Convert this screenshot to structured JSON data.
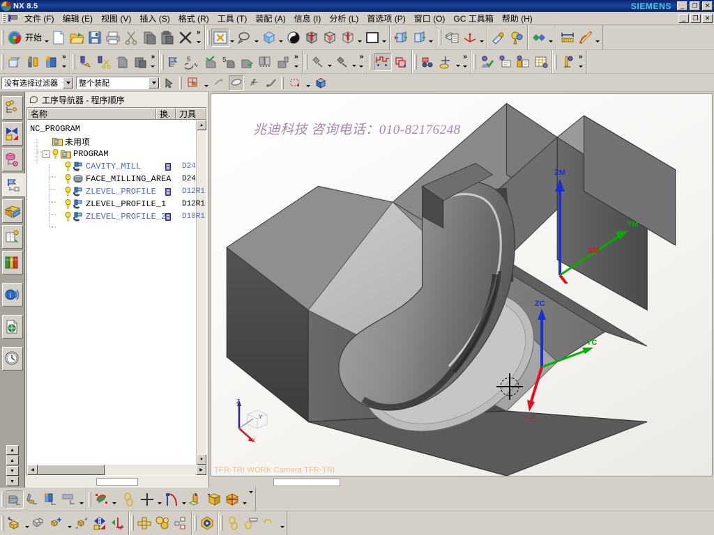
{
  "titlebar": {
    "app_title": "NX 8.5",
    "brand": "SIEMENS",
    "minimize": "_",
    "maximize": "❐",
    "close": "✕"
  },
  "menubar": {
    "items": [
      {
        "label": "文件 (F)",
        "name": "menu-file"
      },
      {
        "label": "编辑 (E)",
        "name": "menu-edit"
      },
      {
        "label": "视图 (V)",
        "name": "menu-view"
      },
      {
        "label": "插入 (S)",
        "name": "menu-insert"
      },
      {
        "label": "格式 (R)",
        "name": "menu-format"
      },
      {
        "label": "工具 (T)",
        "name": "menu-tools"
      },
      {
        "label": "装配 (A)",
        "name": "menu-assembly"
      },
      {
        "label": "信息 (I)",
        "name": "menu-information"
      },
      {
        "label": "分析 (L)",
        "name": "menu-analysis"
      },
      {
        "label": "首选项 (P)",
        "name": "menu-preferences"
      },
      {
        "label": "窗口 (O)",
        "name": "menu-window"
      },
      {
        "label": "GC 工具箱",
        "name": "menu-gc-toolbox"
      },
      {
        "label": "帮助 (H)",
        "name": "menu-help"
      }
    ],
    "min": "_",
    "max": "❐",
    "close": "✕"
  },
  "standard_toolbar": {
    "start_label": "开始",
    "buttons": [
      {
        "name": "new-file-button",
        "icon": "new-document-icon"
      },
      {
        "name": "open-file-button",
        "icon": "open-folder-icon"
      },
      {
        "name": "save-button",
        "icon": "floppy-disk-icon"
      },
      {
        "name": "print-button",
        "icon": "printer-icon"
      },
      {
        "name": "cut-button",
        "icon": "scissors-icon"
      },
      {
        "name": "copy-button",
        "icon": "copy-icon"
      },
      {
        "name": "paste-button",
        "icon": "paste-icon"
      },
      {
        "name": "delete-button",
        "icon": "x-delete-icon"
      }
    ],
    "overflow": "»"
  },
  "view_toolbar": {
    "buttons": [
      {
        "name": "fit-view-button",
        "icon": "fit-star-icon"
      },
      {
        "name": "zoom-button",
        "icon": "magnify-icon"
      },
      {
        "name": "rotate-button",
        "icon": "blue-cube-icon"
      },
      {
        "name": "shaded-render-button",
        "icon": "half-sphere-icon"
      },
      {
        "name": "shaded-edges-button",
        "icon": "shaded-box-icon"
      },
      {
        "name": "static-wireframe-button",
        "icon": "wireframe-box-icon"
      },
      {
        "name": "wireframe-button",
        "icon": "outline-box-icon"
      },
      {
        "name": "background-color-button",
        "icon": "white-square-icon"
      },
      {
        "name": "clip-section-button",
        "icon": "section-icon"
      },
      {
        "name": "section-view-button",
        "icon": "section2-icon"
      },
      {
        "name": "layer-settings-button",
        "icon": "layers-icon"
      },
      {
        "name": "wcs-dynamics-button",
        "icon": "wcs-axis-icon"
      },
      {
        "name": "measure-distance-button",
        "icon": "ruler-icon"
      },
      {
        "name": "measure-angle-button",
        "icon": "protractor-icon"
      },
      {
        "name": "move-object-button",
        "icon": "move-object-icon"
      },
      {
        "name": "analysis-button",
        "icon": "analysis-icon"
      }
    ]
  },
  "cam_toolbar": {
    "groups": [
      {
        "name": "insert-group",
        "buttons": [
          "create-geometry-icon",
          "create-tool-icon",
          "create-method-icon"
        ]
      },
      {
        "name": "operation-group",
        "buttons": [
          "create-operation-icon",
          "cut-operation-icon",
          "copy-operation-icon",
          "paste-operation-icon"
        ]
      },
      {
        "name": "generate-group",
        "buttons": [
          "generate-toolpath-icon",
          "replay-toolpath-icon",
          "verify-toolpath-icon",
          "list-toolpath-icon",
          "confirm-toolpath-icon",
          "compare-icon",
          "machine-icon"
        ]
      },
      {
        "name": "postprocess-group",
        "buttons": [
          "post-process-icon",
          "output-cls-icon"
        ]
      },
      {
        "name": "workpiece-group",
        "buttons": [
          "workpiece-icon",
          "blank-icon"
        ]
      },
      {
        "name": "simulate-group",
        "buttons": [
          "simulate-icon",
          "tool-path-icon"
        ]
      },
      {
        "name": "approve-group",
        "buttons": [
          "approve-icon",
          "shop-doc-icon",
          "report-icon",
          "spreadsheet-icon"
        ]
      },
      {
        "name": "misc-group",
        "buttons": [
          "misc-icon"
        ]
      }
    ],
    "overflow": "»"
  },
  "selection_bar": {
    "filter_value": "没有选择过滤器",
    "scope_value": "整个装配",
    "buttons": [
      {
        "name": "select-general-button",
        "icon": "select-cursor-icon"
      },
      {
        "name": "snap-point-button",
        "icon": "snap-point-icon"
      },
      {
        "name": "point-on-curve-button",
        "icon": "point-curve-icon"
      },
      {
        "name": "face-select-button",
        "icon": "face-select-icon"
      },
      {
        "name": "intersection-point-button",
        "icon": "intersection-icon"
      },
      {
        "name": "curve-select-button",
        "icon": "curve-select-icon"
      },
      {
        "name": "rectangle-select-button",
        "icon": "rect-select-icon"
      },
      {
        "name": "orient-view-button",
        "icon": "orient-cube-icon"
      }
    ]
  },
  "resource_bar": {
    "tabs": [
      {
        "name": "assembly-navigator-tab",
        "icon": "assembly-tree-icon"
      },
      {
        "name": "constraint-navigator-tab",
        "icon": "constraint-icon"
      },
      {
        "name": "part-navigator-tab",
        "icon": "part-cylinder-icon"
      },
      {
        "name": "operation-navigator-tab",
        "icon": "operation-tree-icon",
        "active": true
      },
      {
        "name": "reuse-library-tab",
        "icon": "reuse-library-icon"
      },
      {
        "name": "html-help-tab",
        "icon": "html-help-icon"
      },
      {
        "name": "part-library-tab",
        "icon": "books-icon"
      },
      {
        "name": "internet-explorer-tab",
        "icon": "info-broadcast-icon"
      },
      {
        "name": "web-browser-tab",
        "icon": "web-page-icon"
      },
      {
        "name": "history-tab",
        "icon": "clock-history-icon"
      }
    ],
    "scroll": [
      "▲",
      "▲",
      "▼",
      "▼"
    ]
  },
  "navigator": {
    "title": "工序导航器 - 程序顺序",
    "columns": [
      {
        "label": "名称",
        "name": "column-name"
      },
      {
        "label": "换.",
        "name": "column-change"
      },
      {
        "label": "刀具",
        "name": "column-tool"
      }
    ],
    "rows": [
      {
        "label": "NC_PROGRAM",
        "indent": 0,
        "type": "root",
        "blue": false,
        "cn": false,
        "expander": "",
        "warn": false,
        "icon": "",
        "change": false,
        "tool": ""
      },
      {
        "label": "未用项",
        "indent": 1,
        "type": "group",
        "blue": false,
        "cn": true,
        "expander": "",
        "warn": false,
        "icon": "program-folder-icon",
        "change": false,
        "tool": ""
      },
      {
        "label": "PROGRAM",
        "indent": 1,
        "type": "group",
        "blue": false,
        "cn": false,
        "expander": "-",
        "warn": true,
        "icon": "program-folder-icon",
        "change": false,
        "tool": ""
      },
      {
        "label": "CAVITY_MILL",
        "indent": 2,
        "type": "op",
        "blue": true,
        "cn": false,
        "expander": "",
        "warn": true,
        "icon": "cavity-mill-icon",
        "change": true,
        "tool": "D24"
      },
      {
        "label": "FACE_MILLING_AREA",
        "indent": 2,
        "type": "op",
        "blue": false,
        "cn": false,
        "expander": "",
        "warn": true,
        "icon": "face-milling-icon",
        "change": false,
        "tool": "D24"
      },
      {
        "label": "ZLEVEL_PROFILE",
        "indent": 2,
        "type": "op",
        "blue": true,
        "cn": false,
        "expander": "",
        "warn": true,
        "icon": "zlevel-profile-icon",
        "change": true,
        "tool": "D12R1"
      },
      {
        "label": "ZLEVEL_PROFILE_1",
        "indent": 2,
        "type": "op",
        "blue": false,
        "cn": false,
        "expander": "",
        "warn": true,
        "icon": "zlevel-profile-icon",
        "change": false,
        "tool": "D12R1"
      },
      {
        "label": "ZLEVEL_PROFILE_2",
        "indent": 2,
        "type": "op",
        "blue": true,
        "cn": false,
        "expander": "",
        "warn": true,
        "icon": "zlevel-profile-icon",
        "change": true,
        "tool": "D10R1"
      }
    ]
  },
  "graphics": {
    "watermark": "兆迪科技  咨询电话：010-82176248",
    "status_text": "TFR-TRI WORK Camera TFR-TRI",
    "wcs_machine": {
      "z": "ZM",
      "y": "YM",
      "x": "XM"
    },
    "wcs_work": {
      "z": "ZC",
      "y": "YC",
      "x": "XC"
    },
    "corner_triad": {
      "z": "Z",
      "y": "Y",
      "x": "X"
    },
    "colors": {
      "axis_z": "#1a2ed2",
      "axis_y": "#00b000",
      "axis_x": "#e01020",
      "model_light": "#b8b8b8",
      "model_mid": "#8a8a8a",
      "model_dark": "#4a4a4a",
      "watermark": "#9d7fa8",
      "status": "#e0c49a"
    }
  },
  "bottom_toolbar_1": {
    "buttons": [
      {
        "name": "create-geometry-button",
        "icon": "geometry-icon",
        "pressed": true
      },
      {
        "name": "create-tool-button",
        "icon": "tool-icon"
      },
      {
        "name": "create-method-button",
        "icon": "method-icon"
      },
      {
        "name": "create-program-button",
        "icon": "program-icon"
      },
      {
        "name": "analysis-color-button",
        "icon": "color-analysis-icon"
      },
      {
        "name": "chain-button",
        "icon": "chain-icon"
      },
      {
        "name": "point-button",
        "icon": "plus-point-icon"
      },
      {
        "name": "curve-button",
        "icon": "curve-arc-icon"
      },
      {
        "name": "extrude-button",
        "icon": "extrude-icon"
      },
      {
        "name": "block-button",
        "icon": "yellow-block-icon"
      },
      {
        "name": "gift-pattern-button",
        "icon": "pattern-icon"
      }
    ]
  },
  "bottom_toolbar_2": {
    "buttons": [
      {
        "name": "sketch-button",
        "icon": "sketch-cube-icon"
      },
      {
        "name": "datum-button",
        "icon": "gray-cube-icon"
      },
      {
        "name": "add-feature-button",
        "icon": "add-cube-icon"
      },
      {
        "name": "move-face-button",
        "icon": "move-face-icon"
      },
      {
        "name": "mirror-button",
        "icon": "mirror-icon"
      },
      {
        "name": "perpendicular-button",
        "icon": "perpendicular-icon"
      },
      {
        "name": "pattern-feature-button",
        "icon": "pattern-feature-icon"
      },
      {
        "name": "blend-button",
        "icon": "blend-icon"
      },
      {
        "name": "offset-button",
        "icon": "offset-icon"
      },
      {
        "name": "shell-button",
        "icon": "hex-shell-icon"
      },
      {
        "name": "chain-curve-button",
        "icon": "chain-curve-icon"
      },
      {
        "name": "measure-button",
        "icon": "measure-tool-icon"
      },
      {
        "name": "more-button",
        "icon": "more-icon"
      }
    ]
  }
}
